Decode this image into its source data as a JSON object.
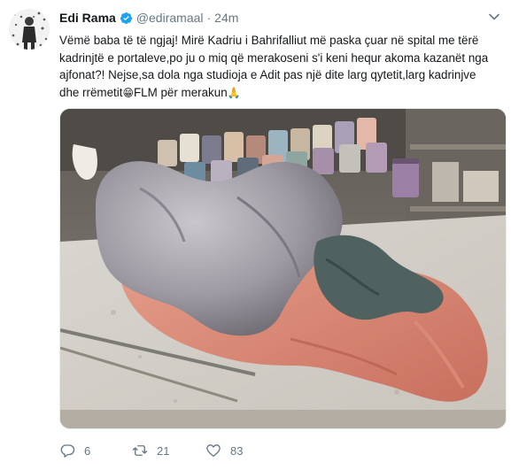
{
  "author": {
    "name": "Edi Rama",
    "handle": "@ediramaal",
    "separator": "·",
    "time": "24m"
  },
  "tweet": {
    "line1": "Vëmë baba të të ngjaj! Mirë Kadriu i Bahrifalliut më paska çuar në spital me tërë",
    "line2": "kadrinjtë e portaleve,po ju o miq që merakoseni s'i keni hequr akoma kazanët nga",
    "line3": "ajfonat?! Nejse,sa dola nga studioja e Adit pas një dite larg qytetit,larg kadrinjve",
    "line4a": "dhe rrëmetit",
    "emoji_grin": "😁",
    "line4b": "FLM për merakun",
    "emoji_pray": "🙏"
  },
  "actions": {
    "replies": "6",
    "retweets": "21",
    "likes": "83"
  },
  "colors": {
    "accent": "#1da1f2",
    "muted": "#657786",
    "text": "#14171a"
  },
  "icons": {
    "verified": "verified-badge-icon",
    "menu": "chevron-down-icon",
    "reply": "reply-icon",
    "retweet": "retweet-icon",
    "like": "heart-icon"
  }
}
